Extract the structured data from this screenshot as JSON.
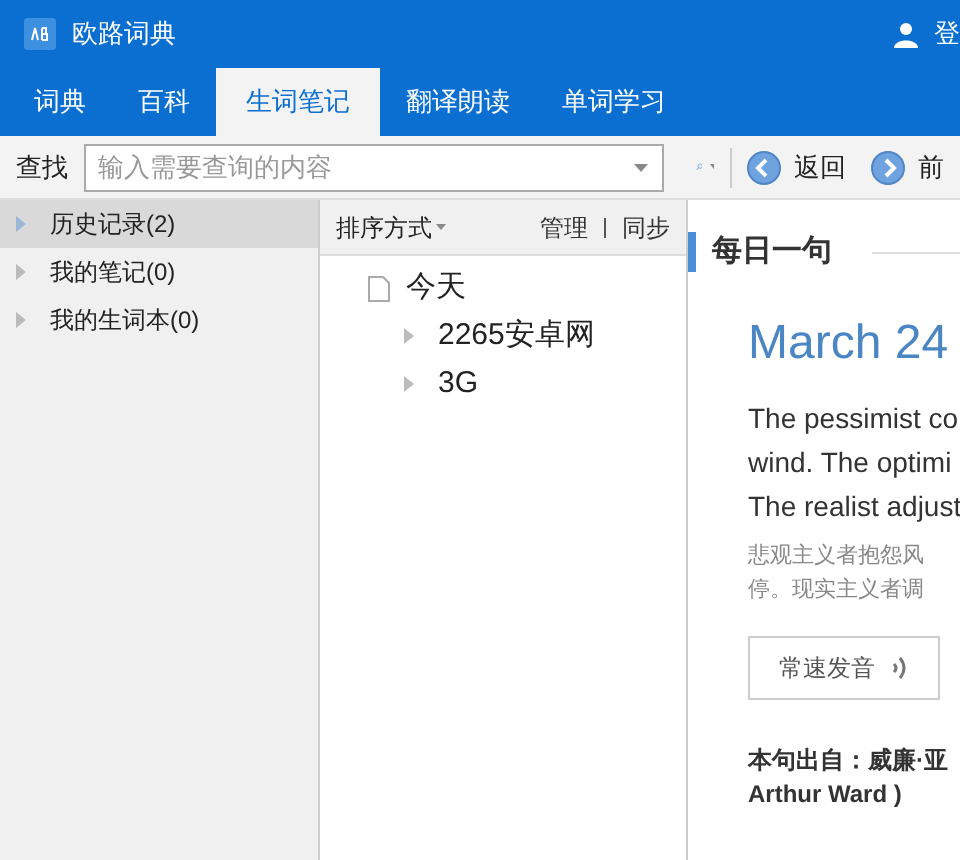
{
  "window": {
    "title": "欧路词典",
    "user_label": "登"
  },
  "tabs": [
    {
      "label": "词典",
      "selected": false
    },
    {
      "label": "百科",
      "selected": false
    },
    {
      "label": "生词笔记",
      "selected": true
    },
    {
      "label": "翻译朗读",
      "selected": false
    },
    {
      "label": "单词学习",
      "selected": false
    }
  ],
  "search": {
    "label": "查找",
    "placeholder": "输入需要查询的内容"
  },
  "nav_buttons": [
    {
      "label": "返回",
      "kind": "back"
    },
    {
      "label": "前",
      "kind": "forward"
    }
  ],
  "sidebar": {
    "items": [
      {
        "label": "历史记录(2)",
        "selected": true
      },
      {
        "label": "我的笔记(0)",
        "selected": false
      },
      {
        "label": "我的生词本(0)",
        "selected": false
      }
    ]
  },
  "list": {
    "sort_label": "排序方式",
    "actions": [
      "管理",
      "同步"
    ],
    "groups": [
      {
        "label": "今天",
        "children": [
          {
            "label": "2265安卓网"
          },
          {
            "label": "3G"
          }
        ]
      }
    ]
  },
  "daily": {
    "heading": "每日一句",
    "date": "March 24",
    "english": [
      "The pessimist co",
      "wind. The optimi",
      "The realist adjust"
    ],
    "chinese": [
      "悲观主义者抱怨风",
      "停。现实主义者调"
    ],
    "speak_button": "常速发音",
    "source": [
      "本句出自：威廉·亚",
      "Arthur Ward )"
    ]
  }
}
